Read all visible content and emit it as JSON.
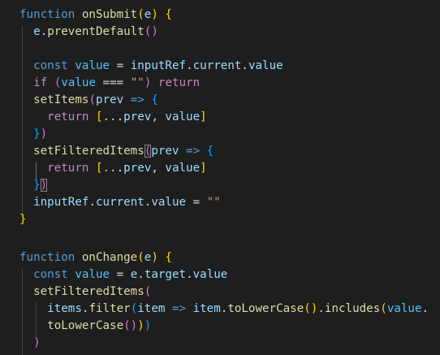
{
  "editor": {
    "language": "javascript",
    "theme_colors": {
      "background": "#1e1e1e",
      "keyword": "#569cd6",
      "control": "#c586c0",
      "function": "#dcdcaa",
      "variable": "#9cdcfe",
      "string": "#ce9178",
      "bracket_level_1": "#ffd700",
      "bracket_level_2": "#da70d6",
      "bracket_level_3": "#179fff"
    },
    "tokens": {
      "kw_function": "function",
      "fn_onSubmit": "onSubmit",
      "param_e": "e",
      "fn_preventDefault": "preventDefault",
      "kw_const": "const",
      "var_value": "value",
      "var_inputRef": "inputRef",
      "prop_current": "current",
      "kw_if": "if",
      "op_strict_eq": "===",
      "str_empty": "\"\"",
      "kw_return": "return",
      "fn_setItems": "setItems",
      "var_prev": "prev",
      "op_arrow": "=>",
      "spread": "...",
      "fn_setFilteredItems": "setFilteredItems",
      "op_assign": "=",
      "fn_onChange": "onChange",
      "prop_target": "target",
      "var_items": "items",
      "fn_filter": "filter",
      "var_item": "item",
      "fn_toLowerCase": "toLowerCase",
      "fn_includes": "includes"
    }
  }
}
